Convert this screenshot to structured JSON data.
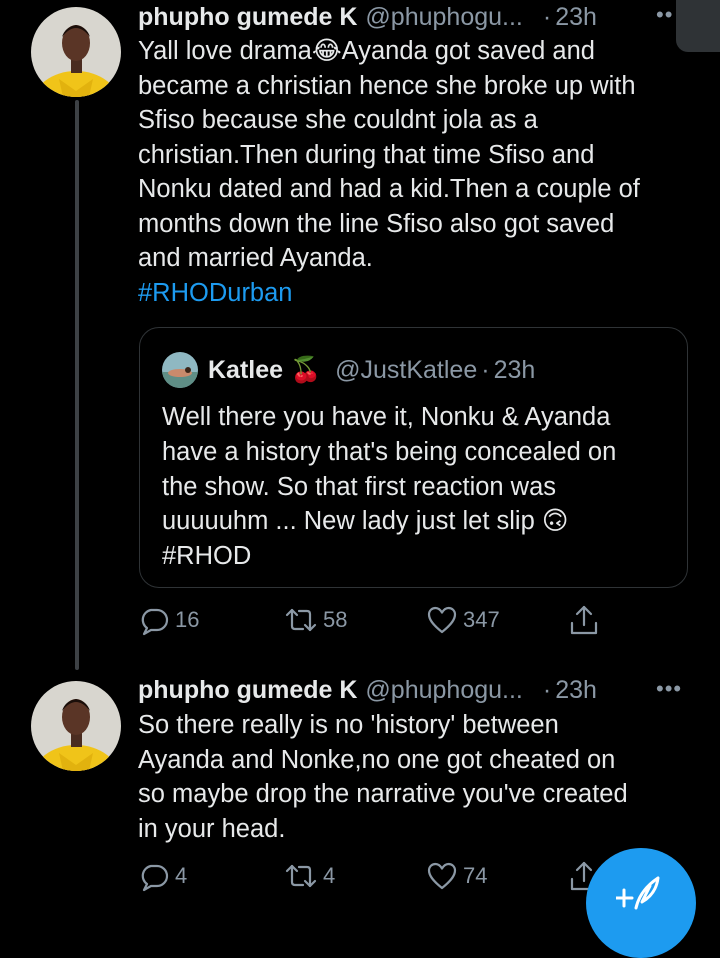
{
  "colors": {
    "background": "#000000",
    "text": "#e7e9ea",
    "secondary": "#8b98a5",
    "link": "#1d9bf0",
    "border": "#2f3336"
  },
  "tweets": [
    {
      "author_name": "phupho gumede K",
      "handle": "@phuphogu...",
      "separator": "·",
      "time": "23h",
      "text": "Yall love drama😂Ayanda got saved and\nbecame a christian hence she broke up with\nSfiso because she couldnt jola as a\nchristian.Then during that time Sfiso and\nNonku dated and had a kid.Then a couple of\nmonths down the line Sfiso also got saved\nand married Ayanda.",
      "hashtag": "#RHODurban",
      "quote": {
        "author_name": "Katlee 🍒",
        "handle": "@JustKatlee",
        "separator": "·",
        "time": "23h",
        "text": "Well there you have it, Nonku & Ayanda\nhave a history that's being concealed on\nthe show. So that first reaction was\nuuuuuhm ... New lady just let slip 🙃\n#RHOD"
      },
      "actions": {
        "replies": "16",
        "retweets": "58",
        "likes": "347"
      }
    },
    {
      "author_name": "phupho gumede K",
      "handle": "@phuphogu...",
      "separator": "·",
      "time": "23h",
      "text": "So there really is no 'history' between\nAyanda and Nonke,no one got cheated on\nso maybe drop the narrative you've created\nin your head.",
      "actions": {
        "replies": "4",
        "retweets": "4",
        "likes": "74"
      }
    }
  ],
  "icons": {
    "reply": "speech-bubble-icon",
    "retweet": "retweet-arrows-icon",
    "like": "heart-outline-icon",
    "share": "share-upload-icon",
    "more": "more-horizontal-icon",
    "compose": "compose-tweet-icon"
  }
}
